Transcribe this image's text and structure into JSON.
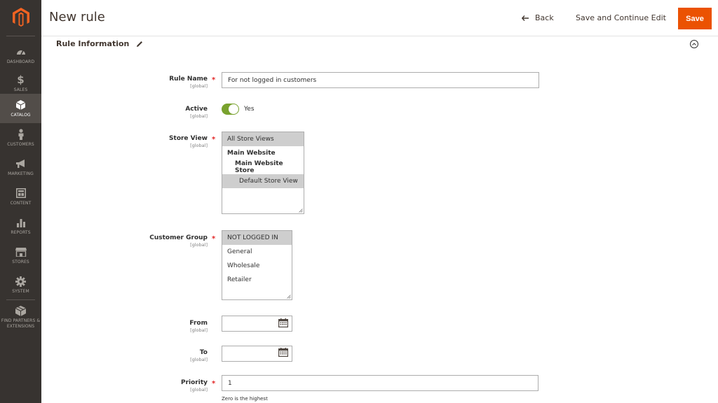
{
  "header": {
    "title": "New rule",
    "back_label": "Back",
    "save_continue_label": "Save and Continue Edit",
    "save_label": "Save"
  },
  "sidebar": {
    "items": [
      {
        "label": "DASHBOARD",
        "icon": "dashboard-icon"
      },
      {
        "label": "SALES",
        "icon": "dollar-icon"
      },
      {
        "label": "CATALOG",
        "icon": "box-icon",
        "active": true
      },
      {
        "label": "CUSTOMERS",
        "icon": "person-icon"
      },
      {
        "label": "MARKETING",
        "icon": "megaphone-icon"
      },
      {
        "label": "CONTENT",
        "icon": "layout-icon"
      },
      {
        "label": "REPORTS",
        "icon": "bar-chart-icon"
      },
      {
        "label": "STORES",
        "icon": "storefront-icon"
      },
      {
        "label": "SYSTEM",
        "icon": "gear-icon"
      },
      {
        "label": "FIND PARTNERS & EXTENSIONS",
        "icon": "cube-icon"
      }
    ]
  },
  "section": {
    "title": "Rule Information"
  },
  "form": {
    "scope_text": "[global]",
    "rule_name": {
      "label": "Rule Name",
      "value": "For not logged in customers"
    },
    "active": {
      "label": "Active",
      "value_text": "Yes",
      "on": true
    },
    "store_view": {
      "label": "Store View",
      "options": [
        {
          "text": "All Store Views",
          "selected": true
        },
        {
          "text": "Main Website",
          "bold": true
        },
        {
          "text": "Main Website Store",
          "bold": true
        },
        {
          "text": "Default Store View",
          "selected": true
        }
      ]
    },
    "customer_group": {
      "label": "Customer Group",
      "options": [
        {
          "text": "NOT LOGGED IN",
          "selected": true
        },
        {
          "text": "General"
        },
        {
          "text": "Wholesale"
        },
        {
          "text": "Retailer"
        }
      ]
    },
    "from": {
      "label": "From",
      "value": ""
    },
    "to": {
      "label": "To",
      "value": ""
    },
    "priority": {
      "label": "Priority",
      "value": "1",
      "note": "Zero is the highest"
    }
  },
  "colors": {
    "sidebar_bg": "#373330",
    "accent": "#eb5202",
    "toggle_on": "#79a22e"
  }
}
